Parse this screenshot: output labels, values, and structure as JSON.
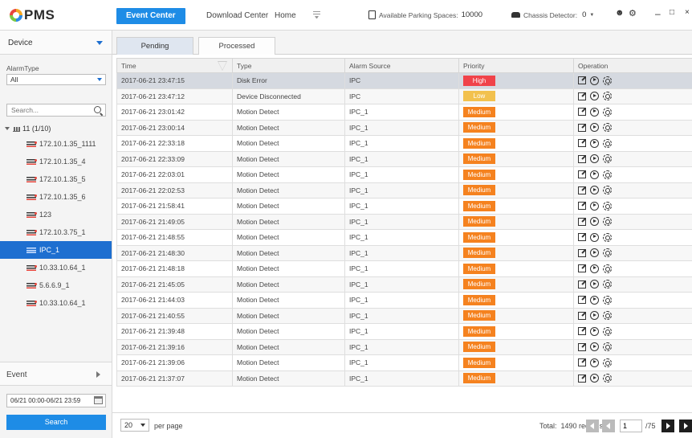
{
  "app": {
    "logo_text": "PMS"
  },
  "nav": {
    "tabs": [
      {
        "label": "Event Center"
      },
      {
        "label": "Download Center"
      },
      {
        "label": "Home"
      }
    ]
  },
  "status": {
    "parking_label": "Available Parking Spaces:",
    "parking_value": "10000",
    "chassis_label": "Chassis Detector:",
    "chassis_value": "0"
  },
  "sidebar": {
    "device_title": "Device",
    "alarm_type_label": "AlarmType",
    "alarm_type_value": "All",
    "search_placeholder": "Search...",
    "tree_root": "11 (1/10)",
    "devices": [
      {
        "label": "172.10.1.35_1111"
      },
      {
        "label": "172.10.1.35_4"
      },
      {
        "label": "172.10.1.35_5"
      },
      {
        "label": "172.10.1.35_6"
      },
      {
        "label": "123"
      },
      {
        "label": "172.10.3.75_1"
      },
      {
        "label": "IPC_1"
      },
      {
        "label": "10.33.10.64_1"
      },
      {
        "label": "5.6.6.9_1"
      },
      {
        "label": "10.33.10.64_1"
      }
    ],
    "selected_device_index": 6,
    "event_title": "Event",
    "date_range": "06/21 00:00-06/21 23:59",
    "search_button": "Search"
  },
  "main": {
    "tabs": [
      {
        "label": "Pending"
      },
      {
        "label": "Processed"
      }
    ],
    "columns": [
      "Time",
      "Type",
      "Alarm Source",
      "Priority",
      "Operation"
    ],
    "rows": [
      {
        "time": "2017-06-21 23:47:15",
        "type": "Disk Error",
        "source": "IPC",
        "priority": "High"
      },
      {
        "time": "2017-06-21 23:47:12",
        "type": "Device Disconnected",
        "source": "IPC",
        "priority": "Low"
      },
      {
        "time": "2017-06-21 23:01:42",
        "type": "Motion Detect",
        "source": "IPC_1",
        "priority": "Medium"
      },
      {
        "time": "2017-06-21 23:00:14",
        "type": "Motion Detect",
        "source": "IPC_1",
        "priority": "Medium"
      },
      {
        "time": "2017-06-21 22:33:18",
        "type": "Motion Detect",
        "source": "IPC_1",
        "priority": "Medium"
      },
      {
        "time": "2017-06-21 22:33:09",
        "type": "Motion Detect",
        "source": "IPC_1",
        "priority": "Medium"
      },
      {
        "time": "2017-06-21 22:03:01",
        "type": "Motion Detect",
        "source": "IPC_1",
        "priority": "Medium"
      },
      {
        "time": "2017-06-21 22:02:53",
        "type": "Motion Detect",
        "source": "IPC_1",
        "priority": "Medium"
      },
      {
        "time": "2017-06-21 21:58:41",
        "type": "Motion Detect",
        "source": "IPC_1",
        "priority": "Medium"
      },
      {
        "time": "2017-06-21 21:49:05",
        "type": "Motion Detect",
        "source": "IPC_1",
        "priority": "Medium"
      },
      {
        "time": "2017-06-21 21:48:55",
        "type": "Motion Detect",
        "source": "IPC_1",
        "priority": "Medium"
      },
      {
        "time": "2017-06-21 21:48:30",
        "type": "Motion Detect",
        "source": "IPC_1",
        "priority": "Medium"
      },
      {
        "time": "2017-06-21 21:48:18",
        "type": "Motion Detect",
        "source": "IPC_1",
        "priority": "Medium"
      },
      {
        "time": "2017-06-21 21:45:05",
        "type": "Motion Detect",
        "source": "IPC_1",
        "priority": "Medium"
      },
      {
        "time": "2017-06-21 21:44:03",
        "type": "Motion Detect",
        "source": "IPC_1",
        "priority": "Medium"
      },
      {
        "time": "2017-06-21 21:40:55",
        "type": "Motion Detect",
        "source": "IPC_1",
        "priority": "Medium"
      },
      {
        "time": "2017-06-21 21:39:48",
        "type": "Motion Detect",
        "source": "IPC_1",
        "priority": "Medium"
      },
      {
        "time": "2017-06-21 21:39:16",
        "type": "Motion Detect",
        "source": "IPC_1",
        "priority": "Medium"
      },
      {
        "time": "2017-06-21 21:39:06",
        "type": "Motion Detect",
        "source": "IPC_1",
        "priority": "Medium"
      },
      {
        "time": "2017-06-21 21:37:07",
        "type": "Motion Detect",
        "source": "IPC_1",
        "priority": "Medium"
      }
    ],
    "selected_row_index": 0
  },
  "priority_colors": {
    "High": "#f0434a",
    "Low": "#f2c14e",
    "Medium": "#f5821f"
  },
  "icons": {
    "operation": [
      "edit-icon",
      "play-icon",
      "gear-icon"
    ]
  },
  "pager": {
    "page_size": "20",
    "per_page_label": "per page",
    "total_label": "Total:",
    "total_records": "1490 records",
    "current_page": "1",
    "total_pages": "/75"
  }
}
